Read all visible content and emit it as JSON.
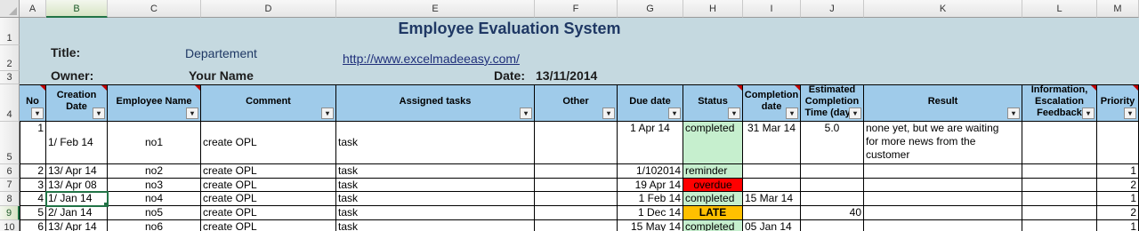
{
  "sheet": {
    "columns": [
      "A",
      "B",
      "C",
      "D",
      "E",
      "F",
      "G",
      "H",
      "I",
      "J",
      "K",
      "L",
      "M"
    ],
    "rows": [
      "1",
      "2",
      "3",
      "4",
      "5",
      "6",
      "7",
      "8",
      "9",
      "10"
    ],
    "title": "Employee Evaluation System",
    "title_label": "Title:",
    "title_value": "Departement",
    "owner_label": "Owner:",
    "owner_value": "Your Name",
    "url": "http://www.excelmadeeasy.com/",
    "date_label": "Date:",
    "date_value": "13/11/2014",
    "headers": {
      "no": "No",
      "creation_date": "Creation Date",
      "employee_name": "Employee Name",
      "comment": "Comment",
      "assigned_tasks": "Assigned tasks",
      "other": "Other",
      "due_date": "Due date",
      "status": "Status",
      "completion_date": "Completion date",
      "estimated_time": "Estimated Completion Time (days)",
      "result": "Result",
      "information": "Information, Escalation Feedback",
      "priority": "Priority"
    },
    "dropdown_glyph": "▾",
    "status_colors": {
      "completed": "#c6efce",
      "reminder": "#c6efce",
      "overdue": "#ff0000",
      "late": "#ffc000"
    },
    "records": [
      {
        "no": "1",
        "creation": "1/ Feb 14",
        "name": "no1",
        "comment": "create OPL",
        "task": "task",
        "other": "",
        "due": "1 Apr 14",
        "status": "completed",
        "completion": "31 Mar 14",
        "estimate": "5.0",
        "result": [
          "none yet, but we are waiting",
          "for more news from the",
          "customer"
        ],
        "info": "",
        "priority": ""
      },
      {
        "no": "2",
        "creation": "13/ Apr 14",
        "name": "no2",
        "comment": "create OPL",
        "task": "task",
        "other": "",
        "due": "1/102014",
        "status": "reminder",
        "completion": "",
        "estimate": "",
        "result": [],
        "info": "",
        "priority": "1"
      },
      {
        "no": "3",
        "creation": "13/ Apr 08",
        "name": "no3",
        "comment": "create OPL",
        "task": "task",
        "other": "",
        "due": "19 Apr 14",
        "status": "overdue",
        "completion": "",
        "estimate": "",
        "result": [],
        "info": "",
        "priority": "2"
      },
      {
        "no": "4",
        "creation": "1/ Jan 14",
        "name": "no4",
        "comment": "create OPL",
        "task": "task",
        "other": "",
        "due": "1 Feb 14",
        "status": "completed",
        "completion": "15 Mar 14",
        "estimate": "",
        "result": [],
        "info": "",
        "priority": "1"
      },
      {
        "no": "5",
        "creation": "2/ Jan 14",
        "name": "no5",
        "comment": "create OPL",
        "task": "task",
        "other": "",
        "due": "1 Dec 14",
        "status": "LATE",
        "completion": "",
        "estimate": "40",
        "result": [],
        "info": "",
        "priority": "2"
      },
      {
        "no": "6",
        "creation": "13/ Apr 14",
        "name": "no6",
        "comment": "create OPL",
        "task": "task",
        "other": "",
        "due": "15 May 14",
        "status": "completed",
        "completion": "05 Jan 14",
        "estimate": "",
        "result": [],
        "info": "",
        "priority": "1"
      }
    ]
  }
}
